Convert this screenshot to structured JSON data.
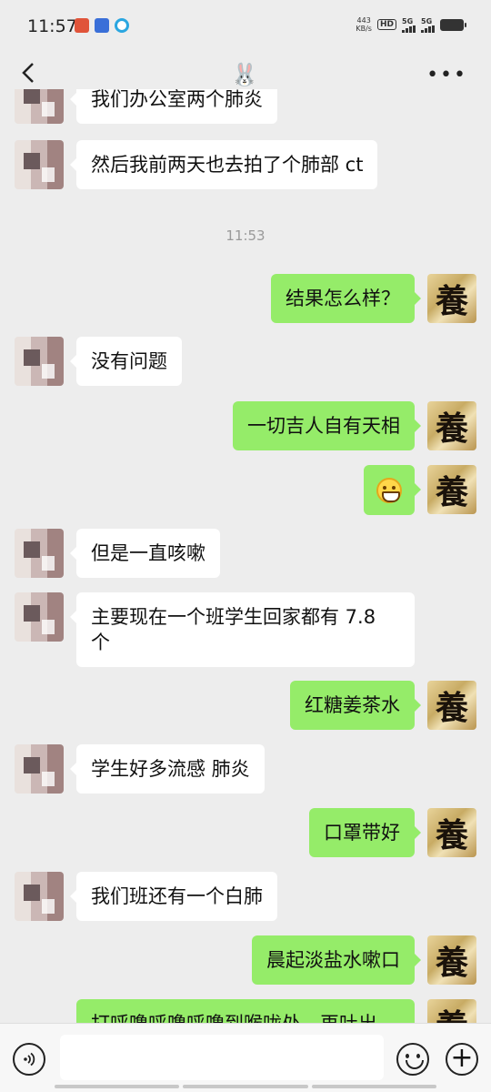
{
  "status_bar": {
    "time": "11:57",
    "net_speed_value": "443",
    "net_speed_unit": "KB/s",
    "hd_badge": "HD",
    "signal_1": "5G",
    "signal_2": "5G"
  },
  "header": {
    "title_icon": "🐰",
    "more": "•••"
  },
  "messages": [
    {
      "side": "left",
      "text": "我们办公室两个肺炎"
    },
    {
      "side": "left",
      "text": "然后我前两天也去拍了个肺部 ct"
    },
    {
      "side": "ts",
      "text": "11:53"
    },
    {
      "side": "right",
      "text": "结果怎么样？"
    },
    {
      "side": "left",
      "text": "没有问题"
    },
    {
      "side": "right",
      "text": "一切吉人自有天相"
    },
    {
      "side": "right",
      "emoji": "grinning-face"
    },
    {
      "side": "left",
      "text": "但是一直咳嗽"
    },
    {
      "side": "left",
      "text": "主要现在一个班学生回家都有 7.8 个"
    },
    {
      "side": "right",
      "text": "红糖姜茶水"
    },
    {
      "side": "left",
      "text": "学生好多流感 肺炎"
    },
    {
      "side": "right",
      "text": "口罩带好"
    },
    {
      "side": "left",
      "text": "我们班还有一个白肺"
    },
    {
      "side": "right",
      "text": "晨起淡盐水嗽口"
    },
    {
      "side": "right",
      "text": "打呼噜呼噜呼噜到喉咙处，再吐出"
    }
  ],
  "my_avatar_char": "養",
  "colors": {
    "my_bubble": "#95ec69",
    "their_bubble": "#ffffff",
    "background": "#ededed"
  },
  "icons": [
    "back-arrow-icon",
    "more-icon",
    "voice-icon",
    "emoji-icon",
    "plus-icon"
  ]
}
